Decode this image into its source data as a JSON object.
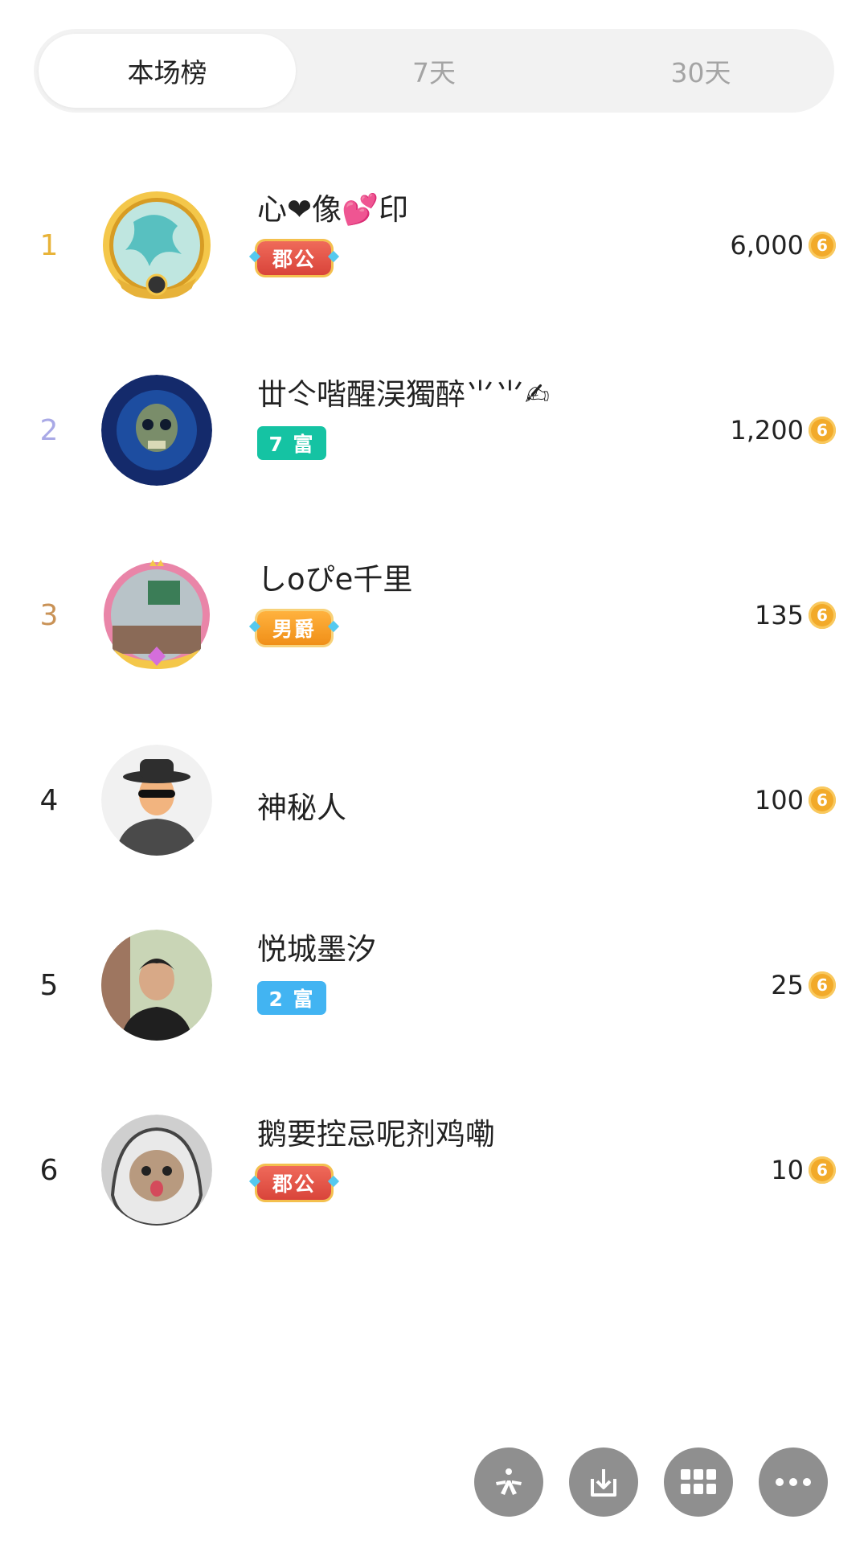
{
  "tabs": [
    {
      "label": "本场榜",
      "active": true
    },
    {
      "label": "7天",
      "active": false
    },
    {
      "label": "30天",
      "active": false
    }
  ],
  "rows": [
    {
      "rank": "1",
      "name": "心❤像💕印",
      "badge": "郡公",
      "score": "6,000",
      "coin_icon": "coin-icon"
    },
    {
      "rank": "2",
      "name": "丗仒喈醒洖獨醉⺌⺌✍",
      "badge": "7 富",
      "score": "1,200",
      "coin_icon": "coin-icon"
    },
    {
      "rank": "3",
      "name": "しoぴe千里",
      "badge": "男爵",
      "score": "135",
      "coin_icon": "coin-icon"
    },
    {
      "rank": "4",
      "name": "神秘人",
      "badge": "",
      "score": "100",
      "coin_icon": "coin-icon"
    },
    {
      "rank": "5",
      "name": "悦城墨汐",
      "badge": "2 富",
      "score": "25",
      "coin_icon": "coin-icon"
    },
    {
      "rank": "6",
      "name": "鹅要控忌呢剂鸡嘞",
      "badge": "郡公",
      "score": "10",
      "coin_icon": "coin-icon"
    }
  ],
  "coin_glyph": "6",
  "colors": {
    "rank1": "#e8b339",
    "rank2": "#a9a9e6",
    "rank3": "#c99256",
    "coin": "#f2aa2a",
    "toolbar_button": "#8f8f8f"
  },
  "toolbar": {
    "icons": [
      "sparkle-icon",
      "download-icon",
      "grid-icon",
      "more-icon"
    ]
  }
}
